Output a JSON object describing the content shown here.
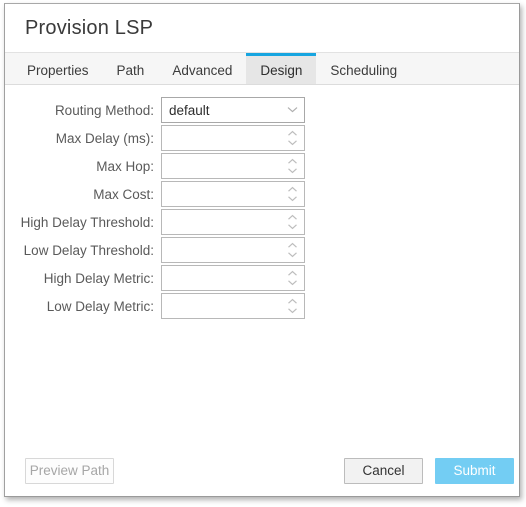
{
  "dialog": {
    "title": "Provision LSP"
  },
  "tabs": [
    {
      "label": "Properties",
      "active": false
    },
    {
      "label": "Path",
      "active": false
    },
    {
      "label": "Advanced",
      "active": false
    },
    {
      "label": "Design",
      "active": true
    },
    {
      "label": "Scheduling",
      "active": false
    }
  ],
  "form": {
    "fields": [
      {
        "label": "Routing Method:",
        "type": "select",
        "value": "default",
        "placeholder": "",
        "icon": "chevron-down-icon",
        "name": "routing-method"
      },
      {
        "label": "Max Delay (ms):",
        "type": "number",
        "value": "",
        "placeholder": "",
        "icon": "spinner-icon",
        "name": "max-delay"
      },
      {
        "label": "Max Hop:",
        "type": "number",
        "value": "",
        "placeholder": "",
        "icon": "spinner-icon",
        "name": "max-hop"
      },
      {
        "label": "Max Cost:",
        "type": "number",
        "value": "",
        "placeholder": "",
        "icon": "spinner-icon",
        "name": "max-cost"
      },
      {
        "label": "High Delay Threshold:",
        "type": "number",
        "value": "",
        "placeholder": "",
        "icon": "spinner-icon",
        "name": "high-delay-threshold"
      },
      {
        "label": "Low Delay Threshold:",
        "type": "number",
        "value": "",
        "placeholder": "",
        "icon": "spinner-icon",
        "name": "low-delay-threshold"
      },
      {
        "label": "High Delay Metric:",
        "type": "number",
        "value": "",
        "placeholder": "",
        "icon": "spinner-icon",
        "name": "high-delay-metric"
      },
      {
        "label": "Low Delay Metric:",
        "type": "number",
        "value": "",
        "placeholder": "",
        "icon": "spinner-icon",
        "name": "low-delay-metric"
      }
    ]
  },
  "footer": {
    "preview_label": "Preview Path",
    "preview_disabled": true,
    "cancel_label": "Cancel",
    "submit_label": "Submit"
  },
  "colors": {
    "accent_tab": "#17a5e0",
    "submit_bg": "#73cdf3",
    "active_tab_bg": "#e6e6e6",
    "tabbar_bg": "#f6f6f6",
    "field_border": "#b8b8b8",
    "label_text": "#5a5a5a"
  }
}
